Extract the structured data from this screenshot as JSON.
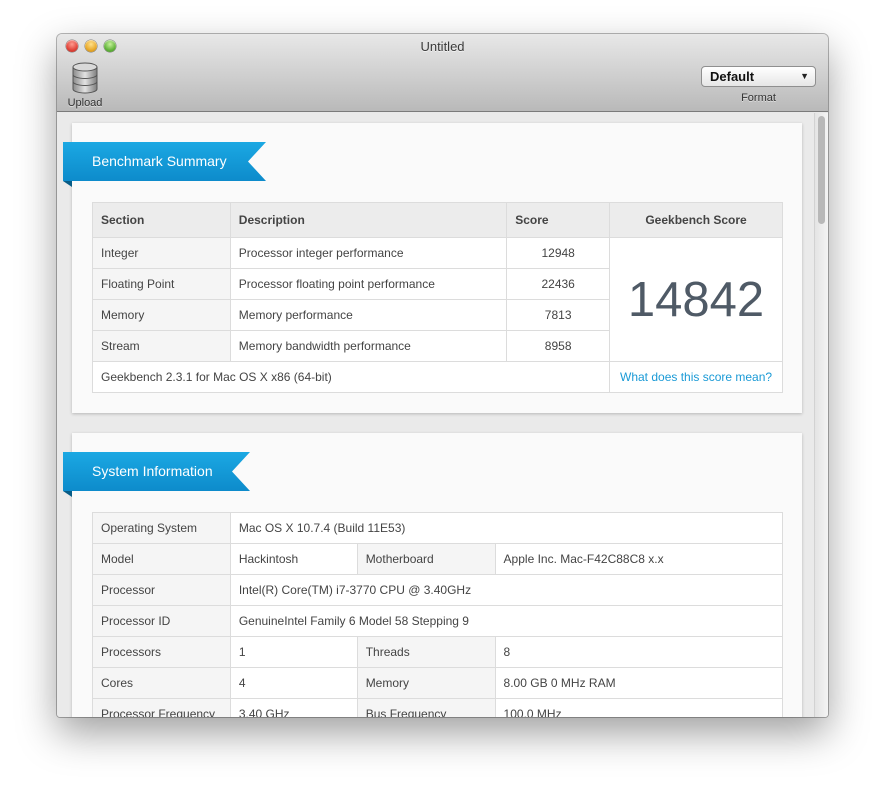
{
  "window": {
    "title": "Untitled"
  },
  "toolbar": {
    "upload_label": "Upload",
    "format_value": "Default",
    "format_label": "Format"
  },
  "colors": {
    "accent": "#1ba8e3",
    "link": "#1a9ad6"
  },
  "summary": {
    "heading": "Benchmark Summary",
    "columns": {
      "section": "Section",
      "description": "Description",
      "score": "Score",
      "geekbench": "Geekbench Score"
    },
    "rows": [
      {
        "section": "Integer",
        "description": "Processor integer performance",
        "score": "12948"
      },
      {
        "section": "Floating Point",
        "description": "Processor floating point performance",
        "score": "22436"
      },
      {
        "section": "Memory",
        "description": "Memory performance",
        "score": "7813"
      },
      {
        "section": "Stream",
        "description": "Memory bandwidth performance",
        "score": "8958"
      }
    ],
    "geekbench_score": "14842",
    "version": "Geekbench 2.3.1 for Mac OS X x86 (64-bit)",
    "score_link": "What does this score mean?"
  },
  "system": {
    "heading": "System Information",
    "os_label": "Operating System",
    "os_value": "Mac OS X 10.7.4 (Build 11E53)",
    "model_label": "Model",
    "model_value": "Hackintosh",
    "motherboard_label": "Motherboard",
    "motherboard_value": "Apple Inc. Mac-F42C88C8 x.x",
    "processor_label": "Processor",
    "processor_value": "Intel(R) Core(TM) i7-3770 CPU @ 3.40GHz",
    "processor_id_label": "Processor ID",
    "processor_id_value": "GenuineIntel Family 6 Model 58 Stepping 9",
    "processors_label": "Processors",
    "processors_value": "1",
    "threads_label": "Threads",
    "threads_value": "8",
    "cores_label": "Cores",
    "cores_value": "4",
    "memory_label": "Memory",
    "memory_value": "8.00 GB 0 MHz RAM",
    "freq_label": "Processor Frequency",
    "freq_value": "3.40 GHz",
    "bus_label": "Bus Frequency",
    "bus_value": "100.0 MHz"
  }
}
